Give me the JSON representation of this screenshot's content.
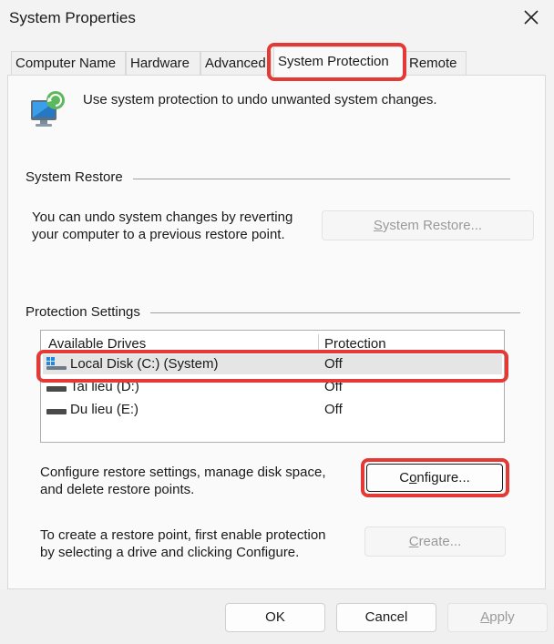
{
  "window": {
    "title": "System Properties"
  },
  "tabs": [
    {
      "label": "Computer Name"
    },
    {
      "label": "Hardware"
    },
    {
      "label": "Advanced"
    },
    {
      "label": "System Protection"
    },
    {
      "label": "Remote"
    }
  ],
  "intro": {
    "text": "Use system protection to undo unwanted system changes."
  },
  "system_restore": {
    "heading": "System Restore",
    "description_line1": "You can undo system changes by reverting",
    "description_line2": "your computer to a previous restore point.",
    "button_rest": "ystem Restore...",
    "button_mnemonic": "S"
  },
  "protection": {
    "heading": "Protection Settings",
    "columns": [
      "Available Drives",
      "Protection"
    ],
    "drives": [
      {
        "name": "Local Disk (C:) (System)",
        "protection": "Off",
        "icon": "system-drive-icon"
      },
      {
        "name": "Tai lieu (D:)",
        "protection": "Off",
        "icon": "drive-icon"
      },
      {
        "name": "Du lieu (E:)",
        "protection": "Off",
        "icon": "drive-icon"
      }
    ],
    "configure_line1": "Configure restore settings, manage disk space,",
    "configure_line2": "and delete restore points.",
    "configure_prefix": "C",
    "configure_mnemonic": "o",
    "configure_rest": "nfigure...",
    "create_line1": "To create a restore point, first enable protection",
    "create_line2": "by selecting a drive and clicking Configure.",
    "create_mnemonic": "C",
    "create_rest": "reate..."
  },
  "footer": {
    "ok_label": "OK",
    "cancel_label": "Cancel",
    "apply_mnemonic": "A",
    "apply_rest": "pply"
  },
  "colors": {
    "highlight": "#e53935",
    "accent": "#0067c0"
  }
}
